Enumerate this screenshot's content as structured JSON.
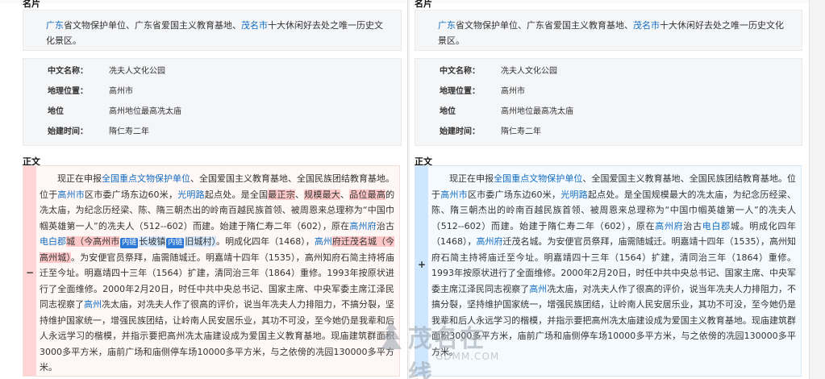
{
  "left": {
    "top_label": "名片",
    "summary": {
      "link1": "广东",
      "text1": "省文物保护单位、广东省爱国主义教育基地、",
      "link2": "茂名市",
      "text2": "十大休闲好去处之唯一历史文化景区。"
    },
    "info": {
      "row1": {
        "key": "中文名称：",
        "value": "冼夫人文化公园"
      },
      "row2": {
        "key": "地理位置：",
        "value": "高州市"
      },
      "row3": {
        "key": "地位",
        "value": "高州地位最高冼太庙"
      },
      "row4": {
        "key": "始建时间：",
        "value": "隋仁寿二年"
      }
    },
    "body_label": "正文",
    "gutter_sign": "−",
    "diff": {
      "s01": "现正在申报",
      "s02": "全国重点文物保护单位",
      "s03": "、全国爱国主义教育基地、全国民族团结教育基地。位于",
      "s04": "高州市",
      "s05": "区市委广场东边60米，",
      "s06": "光明路",
      "s07": "起点处。是全国",
      "s08": "最正宗",
      "s09": "、",
      "s10": "规模最大",
      "s11": "、",
      "s12": "品位最高",
      "s13": "的冼太庙，为纪念历经梁、陈、隋三朝杰出的岭南百越民族首领、被周恩来总理称为“中国巾帼英雄第一人”的冼夫人（512--602）而建。始建于隋仁寿二年（602），原在",
      "s14": "高州府",
      "s15": "治古",
      "s16": "电白郡",
      "s17": "城（今高州市",
      "s18": "内链",
      "s19": "长坡镇",
      "s20": "内链",
      "s21": "旧城村）",
      "s22": "。明成化四年（1468），",
      "s23": "高州",
      "s24": "府迁茂名城（今高州城）",
      "s25": "。为安便官员祭拜，庙需随城迁。明嘉靖十四年（1535），高州知府石简主持将庙迁至今址。明嘉靖四十三年（1564）扩建，清同治三年（1864）重修。1993年按原状进行了全面维修。2000年2月20日，时任中共中央总书记、国家主席、中央军委主席江泽民同志视察了",
      "s26": "高州",
      "s27": "冼太庙，对冼夫人作了很高的评价，说当年冼夫人力排阻力，不搞分裂，坚持维护国家统一，增强民族团结，让岭南人民安居乐业，其功不可没，至今她仍是我辈和后人永远学习的楷模，并指示要把高州冼太庙建设成为爱国主义教育基地。现庙建筑群面积3000多平方米，庙前广场和庙侧停车场10000多平方米，与之依傍的冼园130000多平方米。"
    }
  },
  "right": {
    "top_label": "名片",
    "summary": {
      "link1": "广东",
      "text1": "省文物保护单位、广东省爱国主义教育基地、",
      "link2": "茂名市",
      "text2": "十大休闲好去处之唯一历史文化景区。"
    },
    "info": {
      "row1": {
        "key": "中文名称：",
        "value": "冼夫人文化公园"
      },
      "row2": {
        "key": "地理位置：",
        "value": "高州市"
      },
      "row3": {
        "key": "地位",
        "value": "高州地位最高冼太庙"
      },
      "row4": {
        "key": "始建时间：",
        "value": "隋仁寿二年"
      }
    },
    "body_label": "正文",
    "gutter_sign": "+",
    "diff": {
      "s01": "现正在申报",
      "s02": "全国重点文物保护单位",
      "s03": "、全国爱国主义教育基地、全国民族团结教育基地。位于",
      "s04": "高州市",
      "s05": "区市委广场东边60米，",
      "s06": "光明路",
      "s07": "起点处。是全国规模最大的冼太庙，为纪念历经梁、陈、隋三朝杰出的岭南百越民族首领、被周恩来总理称为“中国巾帼英雄第一人”的冼夫人（512--602）而建。始建于隋仁寿二年（602），原在",
      "s08": "高州府",
      "s09": "治古",
      "s10": "电白郡",
      "s11": "城。明成化四年（1468），",
      "s12": "高州府",
      "s13": "迁茂名城。为安便官员祭拜，庙需随城迁。明嘉靖十四年（1535），高州知府石简主持将庙迁至今址。明嘉靖四十三年（1564）扩建，清同治三年（1864）重修。1993年按原状进行了全面维修。2000年2月20日，时任中共中央总书记、国家主席、中央军委主席江泽民同志视察了",
      "s14": "高州",
      "s15": "冼太庙，对冼夫人作了很高的评价，说当年冼夫人力排阻力，不搞分裂，坚持维护国家统一，增强民族团结，让岭南人民安居乐业，其功不可没，至今她仍是我辈和后人永远学习的楷模，并指示要把高州冼太庙建设成为爱国主义教育基地。现庙建筑群面积3000多平方米，庙前广场和庙侧停车场10000多平方米，与之依傍的冼园130000多平方米。"
    }
  },
  "watermark": {
    "cn": "茂名在线",
    "en": "GDMM.COM"
  }
}
